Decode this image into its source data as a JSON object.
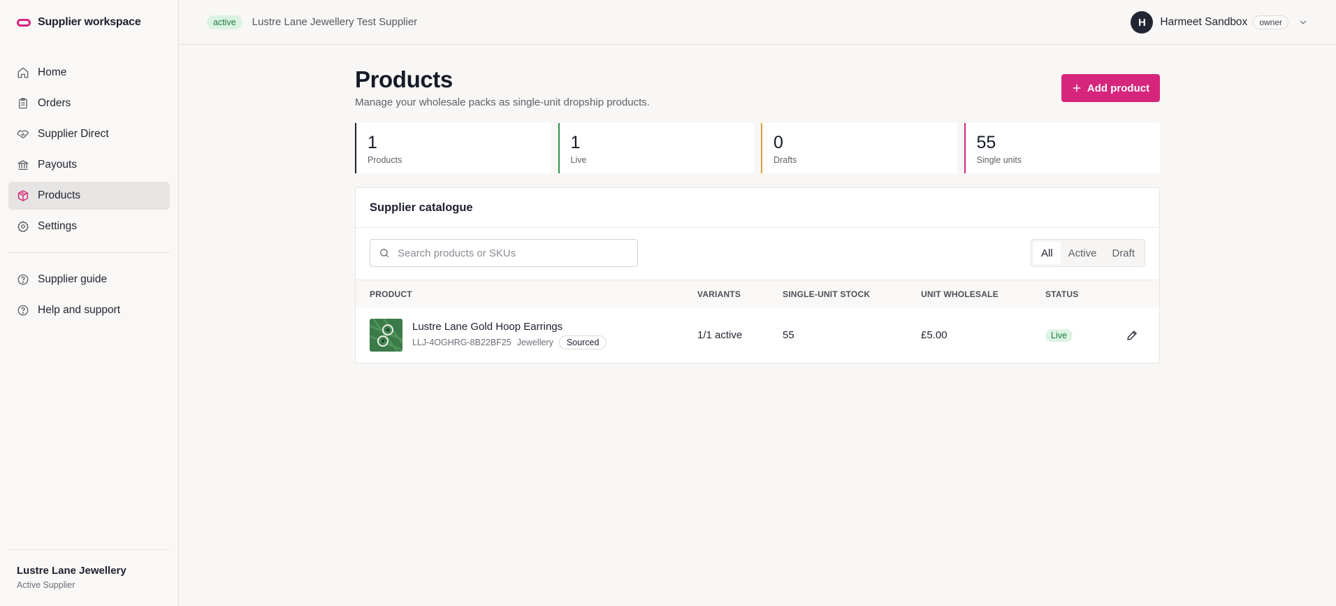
{
  "brand": {
    "name": "Supplier workspace"
  },
  "sidebar": {
    "items": [
      {
        "label": "Home",
        "icon": "home-icon"
      },
      {
        "label": "Orders",
        "icon": "clipboard-icon"
      },
      {
        "label": "Supplier Direct",
        "icon": "handshake-icon"
      },
      {
        "label": "Payouts",
        "icon": "bank-icon"
      },
      {
        "label": "Products",
        "icon": "package-icon",
        "active": true
      },
      {
        "label": "Settings",
        "icon": "gear-icon"
      }
    ],
    "secondary": [
      {
        "label": "Supplier guide",
        "icon": "help-circle-icon"
      },
      {
        "label": "Help and support",
        "icon": "help-circle-icon"
      }
    ],
    "footer": {
      "name": "Lustre Lane Jewellery",
      "subtitle": "Active Supplier"
    }
  },
  "header": {
    "status": "active",
    "supplier": "Lustre Lane Jewellery Test Supplier",
    "user": {
      "initial": "H",
      "name": "Harmeet Sandbox",
      "role": "owner"
    }
  },
  "page": {
    "title": "Products",
    "subtitle": "Manage your wholesale packs as single-unit dropship products.",
    "add_label": "Add product"
  },
  "stats": [
    {
      "value": "1",
      "label": "Products",
      "color": "#1c2030"
    },
    {
      "value": "1",
      "label": "Live",
      "color": "#2f8f4e"
    },
    {
      "value": "0",
      "label": "Drafts",
      "color": "#e0a03a"
    },
    {
      "value": "55",
      "label": "Single units",
      "color": "#d6257c"
    }
  ],
  "catalogue": {
    "title": "Supplier catalogue",
    "search_placeholder": "Search products or SKUs",
    "filters": [
      "All",
      "Active",
      "Draft"
    ],
    "columns": {
      "product": "PRODUCT",
      "variants": "VARIANTS",
      "stock": "SINGLE-UNIT STOCK",
      "wholesale": "UNIT WHOLESALE",
      "status": "STATUS"
    },
    "rows": [
      {
        "name": "Lustre Lane Gold Hoop Earrings",
        "sku": "LLJ-4OGHRG-8B22BF25",
        "category": "Jewellery",
        "tag": "Sourced",
        "variants": "1/1 active",
        "stock": "55",
        "wholesale": "£5.00",
        "status": "Live"
      }
    ]
  },
  "colors": {
    "accent": "#d6257c",
    "success_bg": "#dcf3e3",
    "success_fg": "#1e7b3f"
  }
}
